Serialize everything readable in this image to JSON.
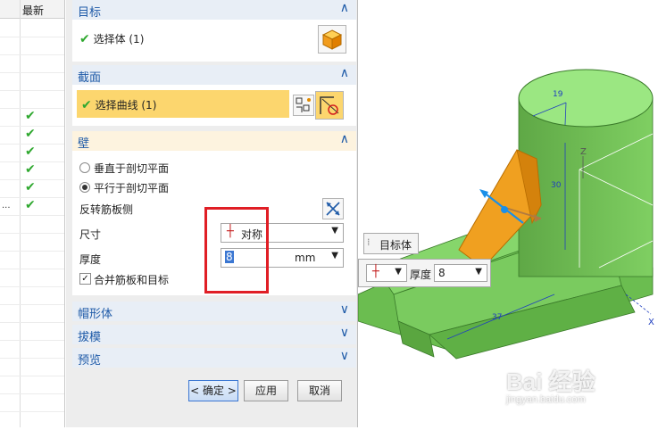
{
  "navigator": {
    "column_header": "最新",
    "rows": [
      "",
      "",
      "",
      "",
      "",
      "",
      "✔",
      "✔",
      "✔",
      "✔",
      "✔",
      "✔",
      "",
      "",
      "",
      "",
      "",
      "",
      "",
      "",
      "",
      "",
      ""
    ],
    "truncated_text": "..."
  },
  "dialog": {
    "target": {
      "title": "目标",
      "select_body": "选择体 (1)",
      "icon": "solid-body-icon"
    },
    "section": {
      "title": "截面",
      "select_curve": "选择曲线 (1)",
      "icons": [
        "curve-rule-icon",
        "sketch-section-icon"
      ]
    },
    "wall": {
      "title": "壁",
      "options": [
        "垂直于剖切平面",
        "平行于剖切平面"
      ],
      "selected_option": "平行于剖切平面",
      "flip_label": "反转筋板侧",
      "flip_icon": "flip-direction-icon",
      "size_label": "尺寸",
      "size_value": "对称",
      "thickness_label": "厚度",
      "thickness_value": "8",
      "thickness_unit": "mm",
      "merge_label": "合并筋板和目标",
      "merge_checked": true
    },
    "collapsed_sections": [
      "帽形体",
      "拔模",
      "预览"
    ],
    "buttons": {
      "ok": "< 确定 >",
      "apply": "应用",
      "cancel": "取消"
    }
  },
  "viewport": {
    "target_label": "目标体",
    "thickness_label": "厚度",
    "thickness_value": "8",
    "dimension_labels": [
      "19",
      "30",
      "37"
    ],
    "axis_labels": [
      "Z",
      "X"
    ],
    "watermark": "Bai 经验",
    "watermark_url": "jingyan.baidu.com"
  },
  "colors": {
    "accent_blue": "#1f5ba8",
    "section_yellow": "#fcd66e",
    "green_check": "#2fa82f",
    "highlight_red": "#e01e25",
    "model_green": "#84d96a",
    "rib_orange": "#f0a020"
  }
}
